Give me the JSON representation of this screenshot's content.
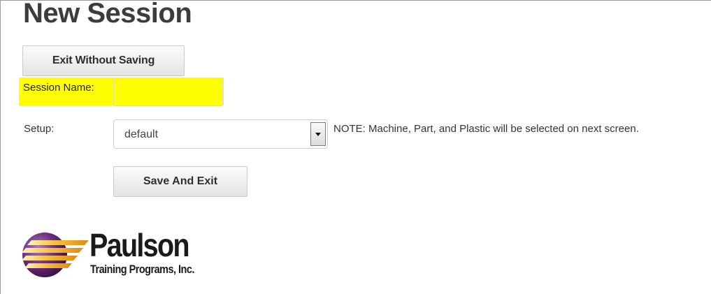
{
  "page": {
    "title": "New Session"
  },
  "buttons": {
    "exit_without_saving": "Exit Without Saving",
    "save_and_exit": "Save And Exit"
  },
  "form": {
    "session_name_label": "Session Name:",
    "session_name_value": "",
    "setup_label": "Setup:",
    "setup_selected": "default",
    "note": "NOTE: Machine, Part, and Plastic will be selected on next screen."
  },
  "logo": {
    "name": "Paulson",
    "subtitle": "Training Programs, Inc."
  },
  "colors": {
    "highlight": "#ffff00",
    "logo_purple": "#6a2c7e",
    "logo_orange": "#f0a020"
  },
  "icons": {
    "select_arrow": "chevron-down-icon",
    "logo_mark": "paulson-globe-icon"
  }
}
